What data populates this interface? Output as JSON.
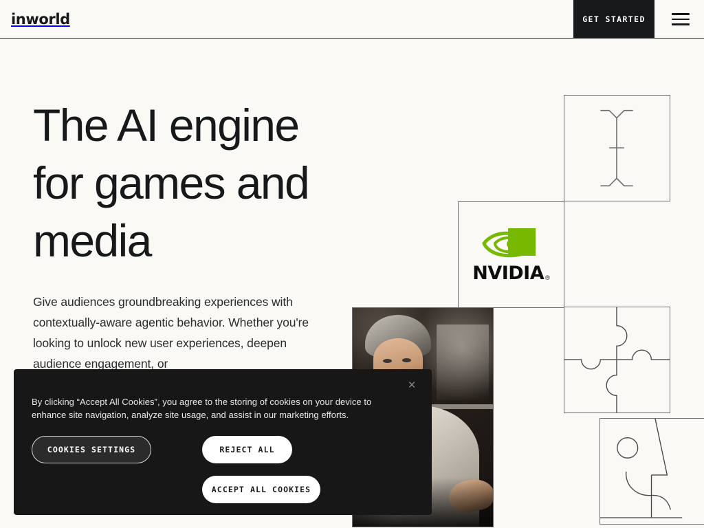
{
  "site": {
    "background_color": "#faf9f5",
    "text_color": "#16181a"
  },
  "header": {
    "logo_text": "inworld",
    "cta_label": "GET STARTED",
    "menu_icon": "hamburger-menu-icon"
  },
  "hero": {
    "title": "The AI engine for games and media",
    "subtitle": "Give audiences groundbreaking experiences with contextually-aware agentic behavior. Whether you're looking to unlock new user experiences, deepen audience engagement, or"
  },
  "collage": {
    "tiles": [
      {
        "name": "text-cursor-ibeam-tile",
        "kind": "lineart",
        "icon": "i-beam-cursor-icon"
      },
      {
        "name": "nvidia-logo-tile",
        "kind": "logo",
        "brand": "NVIDIA",
        "registered_mark": "®",
        "brand_green": "#76b900"
      },
      {
        "name": "character-photo-tile",
        "kind": "photo",
        "description": "Grey-haired man in white shirt in dark interior"
      },
      {
        "name": "puzzle-pieces-tile",
        "kind": "lineart",
        "icon": "jigsaw-puzzle-icon"
      },
      {
        "name": "face-profile-tile",
        "kind": "lineart",
        "icon": "face-profile-icon"
      }
    ],
    "line_color": "#6d6d6d"
  },
  "cookie_banner": {
    "message": "By clicking “Accept All Cookies”, you agree to the storing of cookies on your device to enhance site navigation, analyze site usage, and assist in our marketing efforts.",
    "close_icon": "×",
    "buttons": {
      "settings": "COOKIES SETTINGS",
      "reject": "REJECT ALL",
      "accept": "ACCEPT ALL COOKIES"
    },
    "background_color": "#171717"
  }
}
